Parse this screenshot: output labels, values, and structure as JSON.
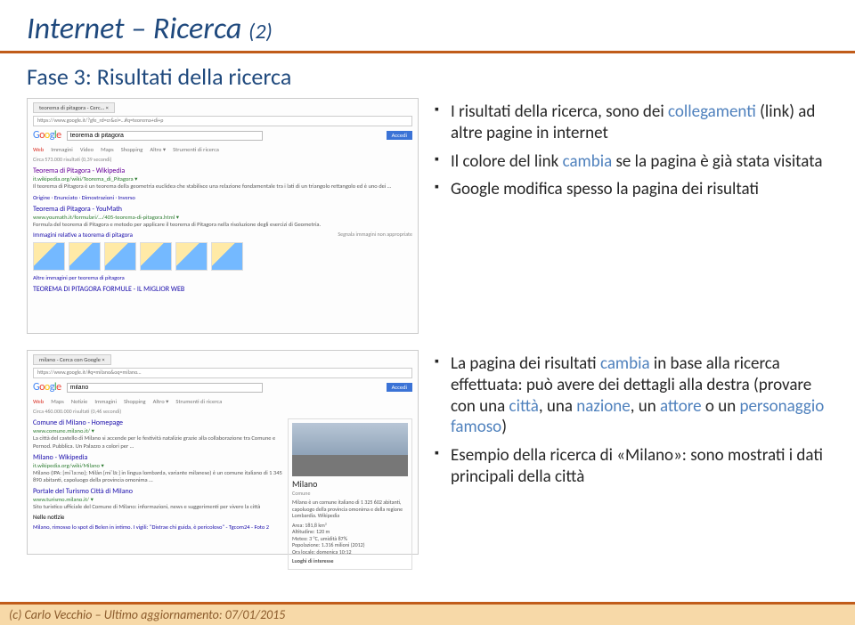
{
  "title_main": "Internet – Ricerca ",
  "title_sub": "(2)",
  "subtitle": "Fase 3: Risultati della ricerca",
  "bullets1": {
    "b1a": "I risultati della ricerca, sono dei ",
    "b1b": "collegamenti ",
    "b1c": "(link) ad altre pagine in internet",
    "b2a": "Il colore del link ",
    "b2b": "cambia ",
    "b2c": "se la pagina è già stata visitata",
    "b3": "Google modifica spesso la pagina dei risultati"
  },
  "bullets2": {
    "b1a": "La pagina dei risultati ",
    "b1b": "cambia ",
    "b1c": "in base alla ricerca effettuata: può avere dei dettagli alla destra (provare con una ",
    "b1d": "città",
    "b1e": ", una ",
    "b1f": "nazione",
    "b1g": ", un ",
    "b1h": "attore ",
    "b1i": "o un ",
    "b1j": "personaggio famoso",
    "b1k": ")",
    "b2": "Esempio della ricerca di «Milano»: sono mostrati i dati principali della città"
  },
  "shot1": {
    "tab": "teorema di pitagora - Cerc…  ×",
    "addr": "https://www.google.it/?gfe_rd=cr&ei=…#q=teorema+di+p",
    "query": "teorema di pitagora",
    "accedi": "Accedi",
    "nav_web": "Web",
    "nav_img": "Immagini",
    "nav_vid": "Video",
    "nav_map": "Maps",
    "nav_shop": "Shopping",
    "nav_alt": "Altro ▾",
    "nav_str": "Strumenti di ricerca",
    "count": "Circa 573.000 risultati (0,39 secondi)",
    "r1t": "Teorema di Pitagora - Wikipedia",
    "r1u": "it.wikipedia.org/wiki/Teorema_di_Pitagora ▾",
    "r1d": "Il teorema di Pitagora è un teorema della geometria euclidea che stabilisce una relazione fondamentale tra i lati di un triangolo rettangolo ed è uno dei …",
    "r1l": "Origine · Enunciato · Dimostrazioni · Inverso",
    "r2t": "Teorema di Pitagora - YouMath",
    "r2u": "www.youmath.it/formulari/…/405-teorema-di-pitagora.html ▾",
    "r2d": "Formula del teorema di Pitagora e metodo per applicare il teorema di Pitagora nella risoluzione degli esercizi di Geometria.",
    "imglbl": "Immagini relative a teorema di pitagora",
    "report": "Segnala immagini non appropriate",
    "more": "Altre immagini per teorema di pitagora",
    "r3t": "TEOREMA DI PITAGORA FORMULE - IL MIGLIOR WEB"
  },
  "shot2": {
    "tab": "milano - Cerca con Google  ×",
    "addr": "https://www.google.it/#q=milano&oq=milano…",
    "query": "milano",
    "accedi": "Accedi",
    "nav_web": "Web",
    "nav_map": "Maps",
    "nav_not": "Notizie",
    "nav_img": "Immagini",
    "nav_shop": "Shopping",
    "nav_alt": "Altro ▾",
    "nav_str": "Strumenti di ricerca",
    "count": "Circa 460.000.000 risultati (0,46 secondi)",
    "r1t": "Comune di Milano - Homepage",
    "r1u": "www.comune.milano.it/ ▾",
    "r1d": "La città del castello di Milano si accende per le festività natalizie grazie alla collaborazione tra Comune e Pernod. Pubblica. Un Palazzo a colori per …",
    "r2t": "Milano - Wikipedia",
    "r2u": "it.wikipedia.org/wiki/Milano ▾",
    "r2d": "Milano (IPA: [miˈlaːno]; Milàn [miˈlãː] in lingua lombarda, variante milanese) è un comune italiano di 1 345 890 abitanti, capoluogo della provincia omonima …",
    "r3t": "Portale del Turismo Città di Milano",
    "r3u": "www.turismo.milano.it/ ▾",
    "r3d": "Sito turistico ufficiale del Comune di Milano: informazioni, news e suggerimenti per vivere la città",
    "news": "Nelle notizie",
    "n1": "Milano, rimosso lo spot di Belen in intimo. I vigili: \"Distrae chi guida, è pericoloso\" - Tgcom24 - Foto 2",
    "card_title": "Milano",
    "card_sub": "Comune",
    "card_d": "Milano è un comune italiano di 1 325 602 abitanti, capoluogo della provincia omonima e della regione Lombardia. Wikipedia",
    "card_area": "Area: 181,8 km²",
    "card_alt": "Altitudine: 120 m",
    "card_met": "Meteo: 3 °C, umidità 87%",
    "card_pop": "Popolazione: 1.316 milioni (2012)",
    "card_ora": "Ora locale: domenica 10:12",
    "card_luo": "Luoghi di interesse"
  },
  "footer": "(c) Carlo Vecchio – Ultimo aggiornamento: 07/01/2015"
}
